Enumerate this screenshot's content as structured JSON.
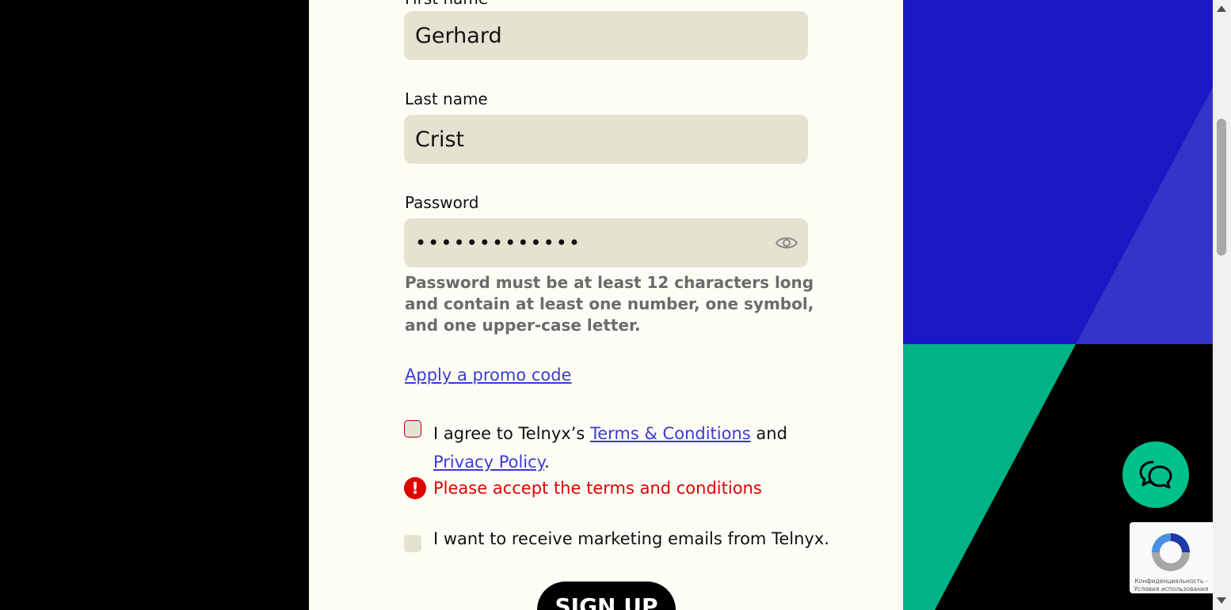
{
  "form": {
    "first_name": {
      "label": "First name",
      "value": "Gerhard"
    },
    "last_name": {
      "label": "Last name",
      "value": "Crist"
    },
    "password": {
      "label": "Password",
      "masked_value": "•••••••••••••",
      "hint": "Password must be at least 12 characters long and contain at least one number, one symbol, and one upper-case letter."
    },
    "promo_link": "Apply a promo code",
    "terms": {
      "prefix": "I agree to Telnyx’s ",
      "terms_link": "Terms & Conditions",
      "middle": " and",
      "privacy_link": "Privacy Policy",
      "suffix": ".",
      "error": "Please accept the terms and conditions"
    },
    "marketing_label": "I want to receive marketing emails from Telnyx.",
    "signup_button": "SIGN UP"
  },
  "recaptcha": {
    "line1": "Конфиденциальность -",
    "line2": "Условия использования"
  },
  "colors": {
    "panel_bg": "#fefdf5",
    "input_bg": "#e6e2d1",
    "link": "#3b3bd6",
    "error": "#e00000",
    "accent_green": "#00c08b",
    "art_blue": "#1a17c4"
  },
  "icons": {
    "password_toggle": "eye-icon",
    "error": "exclamation-circle-icon",
    "chat": "chat-bubbles-icon",
    "recaptcha": "recaptcha-logo-icon"
  }
}
